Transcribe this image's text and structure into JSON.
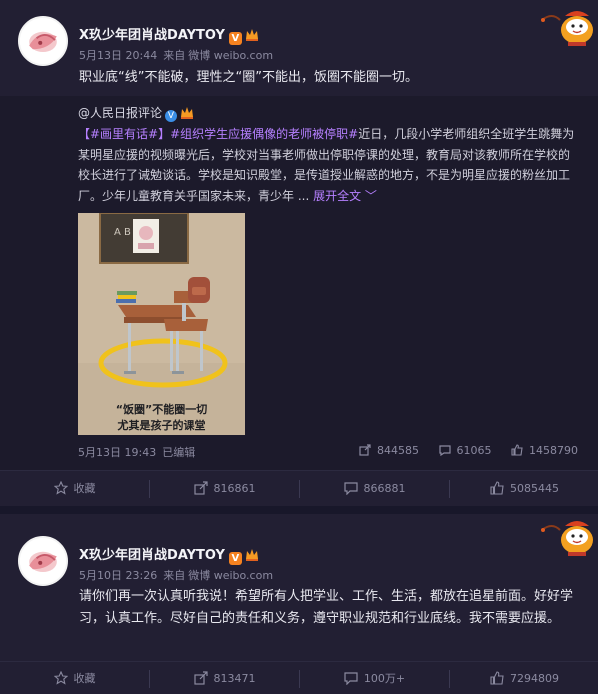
{
  "posts": [
    {
      "username": "X玖少年团肖战DAYTOY",
      "badge": "V",
      "date": "5月13日 20:44",
      "source_prefix": "来自",
      "source": "微博 weibo.com",
      "text": "职业底“线”不能破，理性之“圈”不能出，饭圈不能圈一切。",
      "repost": {
        "author": "@人民日报评论",
        "hashtag1": "【#画里有话#】",
        "hashtag2": "#组织学生应援偶像的老师被停职#",
        "text": "近日，几段小学老师组织全班学生跳舞为某明星应援的视频曝光后，学校对当事老师做出停职停课的处理，教育局对该教师所在学校的校长进行了诫勉谈话。学校是知识殿堂，是传道授业解惑的地方，不是为明星应援的粉丝加工厂。少年儿童教育关乎国家未来，青少年 ...",
        "expand": "展开全文 ﹀",
        "image": {
          "caption_line1": "“饭圈”不能圈一切",
          "caption_line2": "尤其是孩子的课堂",
          "board_text": "A B C"
        },
        "date": "5月13日 19:43",
        "edit_mark": "已编辑",
        "stats": {
          "reposts": "844585",
          "comments": "61065",
          "likes": "1458790"
        }
      },
      "actions": {
        "favorite": "收藏",
        "reposts": "816861",
        "comments": "866881",
        "likes": "5085445"
      }
    },
    {
      "username": "X玖少年团肖战DAYTOY",
      "badge": "V",
      "date": "5月10日 23:26",
      "source_prefix": "来自",
      "source": "微博 weibo.com",
      "text": "请你们再一次认真听我说！希望所有人把学业、工作、生活，都放在追星前面。好好学习，认真工作。尽好自己的责任和义务，遵守职业规范和行业底线。我不需要应援。",
      "actions": {
        "favorite": "收藏",
        "reposts": "813471",
        "comments": "100万+",
        "likes": "7294809"
      }
    }
  ],
  "colors": {
    "accent": "#b680ff",
    "background": "#221f33",
    "repost_bg": "#1c1a2b",
    "badge": "#f58220"
  },
  "icons": [
    "avatar",
    "verified-badge",
    "crown-icon",
    "decorative-lantern-icon",
    "share-icon",
    "comment-icon",
    "like-icon",
    "star-icon"
  ]
}
